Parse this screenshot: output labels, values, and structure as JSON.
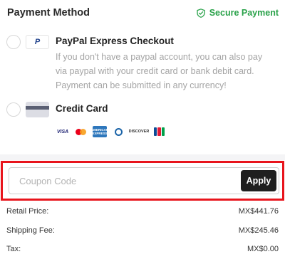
{
  "header": {
    "title": "Payment Method",
    "secure_label": "Secure Payment",
    "secure_color": "#2aa24a"
  },
  "options": [
    {
      "title": "PayPal Express Checkout",
      "description": "If you don't have a paypal account, you can also pay via paypal with your credit card or bank debit card. Payment can be submitted in any currency!",
      "logo_text": "P",
      "selected": false
    },
    {
      "title": "Credit Card",
      "selected": false,
      "card_brands": [
        "VISA",
        "mastercard",
        "AMEX",
        "diners-club",
        "DISCOVER",
        "JCB"
      ],
      "amex_text": "AMERICAN EXPRESS",
      "discover_text": "DISCOVER",
      "visa_text": "VISA"
    }
  ],
  "coupon": {
    "value": "",
    "placeholder": "Coupon Code",
    "apply_label": "Apply",
    "highlight_color": "#e8141c"
  },
  "summary": {
    "rows": [
      {
        "label": "Retail Price:",
        "value": "MX$441.76"
      },
      {
        "label": "Shipping Fee:",
        "value": "MX$245.46"
      },
      {
        "label": "Tax:",
        "value": "MX$0.00"
      }
    ]
  }
}
